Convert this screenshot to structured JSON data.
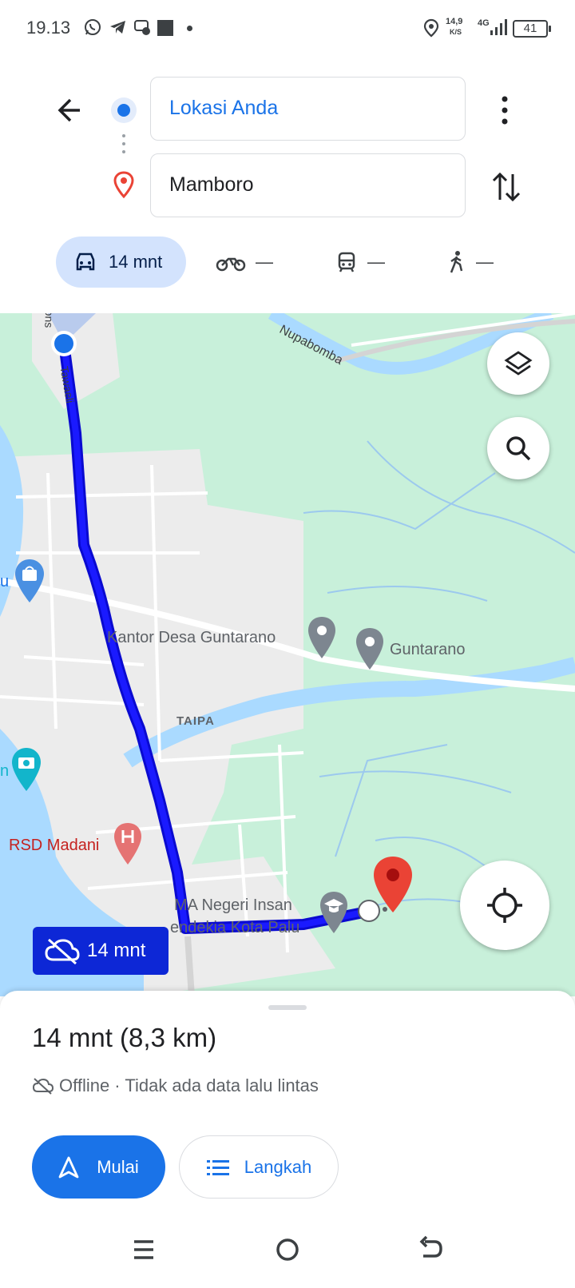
{
  "status_bar": {
    "time": "19.13",
    "speed_top": "14,9",
    "speed_unit": "K/S",
    "network": "4G",
    "battery": "41",
    "left_icons": [
      "whatsapp-icon",
      "telegram-icon",
      "messenger-icon",
      "square-notification-icon",
      "dot-icon"
    ],
    "right_icons": [
      "location-icon",
      "signal-icon",
      "battery-icon"
    ]
  },
  "directions": {
    "origin_value": "Lokasi Anda",
    "destination_value": "Mamboro",
    "modes": [
      {
        "name": "car",
        "label": "14 mnt",
        "selected": true
      },
      {
        "name": "motorcycle",
        "label": "—"
      },
      {
        "name": "transit",
        "label": "—"
      },
      {
        "name": "walk",
        "label": "—"
      }
    ]
  },
  "map": {
    "road_nupabomba": "Nupabomba",
    "road_tawaeli": "Tawaeli",
    "road_poros": "ons",
    "place_kantor": "Kantor Desa Guntarano",
    "place_guntarano": "Guntarano",
    "area_taipa": "TAIPA",
    "place_rsd": "RSD Madani",
    "place_school_1": "MA Negeri Insan",
    "place_school_2": "endekia Kota Palu",
    "edge_u": "u",
    "edge_n": "n",
    "route_time": "14 mnt",
    "colors": {
      "route": "#1a1aff",
      "water": "#aadaff",
      "green": "#c8f0da",
      "urban": "#eeeeee"
    }
  },
  "sheet": {
    "eta": "14 mnt (8,3 km)",
    "status": "Offline · Tidak ada data lalu lintas",
    "start_label": "Mulai",
    "steps_label": "Langkah"
  },
  "colors": {
    "accent": "#1a73e8",
    "chip_selected": "#d3e3fd",
    "pin_red": "#ea4335"
  }
}
